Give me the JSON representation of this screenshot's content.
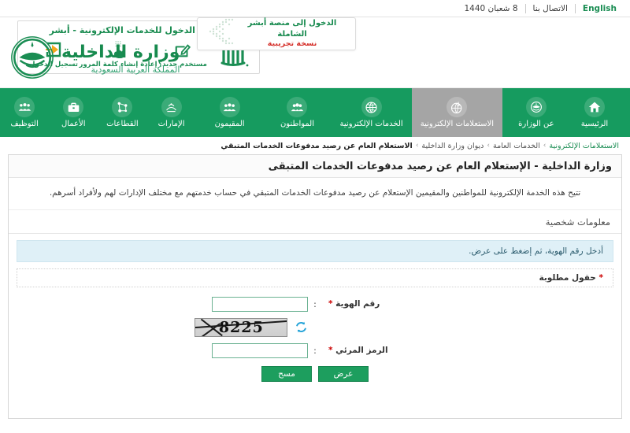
{
  "topbar": {
    "english": "English",
    "contact": "الاتصال بنا",
    "date": "8 شعبان 1440"
  },
  "absher_card": {
    "title": "تسجيل الدخول للخدمات الإلكترونية - أبشر",
    "logo_name": "absher-logo",
    "options": [
      {
        "label": "تسجيل الدخول",
        "icon": "login-arrow-icon"
      },
      {
        "label": "إعادة إنشاء كلمة المرور",
        "icon": "hand-keypad-icon"
      },
      {
        "label": "مستخدم جديد؟",
        "icon": "edit-square-icon"
      }
    ]
  },
  "trial_banner": {
    "line1": "الدخول إلى منصة أبشر الشاملة",
    "line2": "نسخة تجريبية",
    "icon": "chevron-dots-icon"
  },
  "moi": {
    "title": "وزارة الداخلية",
    "subtitle": "المملكة العربية السعودية",
    "emblem": "saudi-moi-emblem"
  },
  "nav": {
    "items": [
      {
        "label": "الرئيسية",
        "icon": "home-icon",
        "active": false
      },
      {
        "label": "عن الوزارة",
        "icon": "ministry-emblem-icon",
        "active": false
      },
      {
        "label": "الاستعلامات الإلكترونية",
        "icon": "inquiry-globe-icon",
        "active": true
      },
      {
        "label": "الخدمات الإلكترونية",
        "icon": "globe-icon",
        "active": false
      },
      {
        "label": "المواطنون",
        "icon": "citizens-icon",
        "active": false
      },
      {
        "label": "المقيمون",
        "icon": "residents-icon",
        "active": false
      },
      {
        "label": "الإمارات",
        "icon": "emirates-icon",
        "active": false
      },
      {
        "label": "القطاعات",
        "icon": "sectors-network-icon",
        "active": false
      },
      {
        "label": "الأعمال",
        "icon": "briefcase-icon",
        "active": false
      },
      {
        "label": "التوظيف",
        "icon": "employment-icon",
        "active": false
      }
    ]
  },
  "breadcrumb": {
    "items": [
      {
        "label": "الاستعلامات الإلكترونية",
        "type": "link"
      },
      {
        "label": "الخدمات العامة",
        "type": "plain"
      },
      {
        "label": "ديوان وزارة الداخلية",
        "type": "plain"
      },
      {
        "label": "الاستعلام العام عن رصيد مدفوعات الخدمات المتبقي",
        "type": "current"
      }
    ],
    "separator": "›"
  },
  "panel": {
    "title": "وزارة الداخلية - الإستعلام العام عن رصيد مدفوعات الخدمات المتبقى",
    "description": "تتيح هذه الخدمة الإلكترونية للمواطنين والمقيمين الإستعلام عن رصيد مدفوعات الخدمات المتبقي في حساب خدمتهم مع مختلف الإدارات لهم ولأفراد أسرهم.",
    "section_title": "معلومات شخصية",
    "info_message": "أدخل رقم الهوية، ثم إضغط على عرض.",
    "required_note": "حقول مطلوبة",
    "required_star": "*",
    "colon": ":",
    "fields": [
      {
        "label": "رقم الهوية",
        "required": true,
        "value": "",
        "placeholder": ""
      },
      {
        "label": "الرمز المرئي",
        "required": true,
        "value": "",
        "placeholder": ""
      }
    ],
    "captcha": {
      "value": "8225",
      "refresh_icon": "refresh-icon"
    },
    "buttons": [
      {
        "label": "عرض",
        "name": "view-button"
      },
      {
        "label": "مسح",
        "name": "clear-button"
      }
    ]
  },
  "colors": {
    "brand_green": "#169b5f",
    "nav_active_gray": "#a5a5a5",
    "link_green": "#1a8d53",
    "required_red": "#cc0000",
    "info_blue_bg": "#dff0f7",
    "trial_red": "#d5312b",
    "button_green": "#1d9e5e"
  }
}
